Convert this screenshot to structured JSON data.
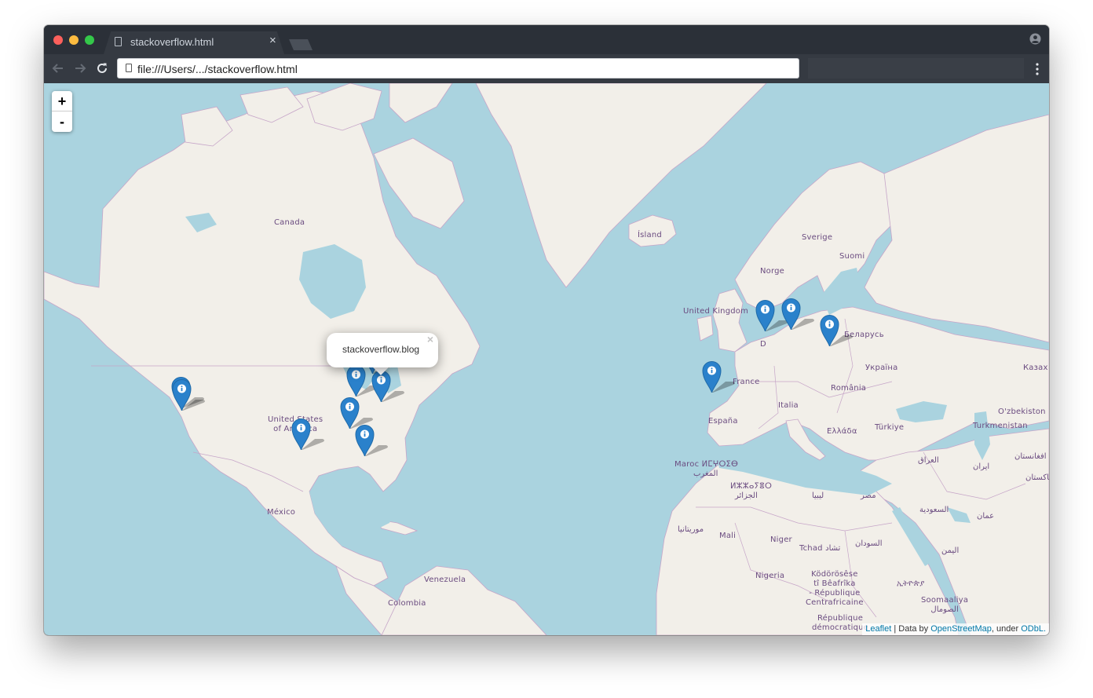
{
  "browser": {
    "tab_title": "stackoverflow.html",
    "tab_close": "×",
    "address": "file:///Users/.../stackoverflow.html"
  },
  "map": {
    "zoom_in": "+",
    "zoom_out": "-",
    "popup": {
      "text": "stackoverflow.blog",
      "close": "×"
    },
    "attribution": {
      "leaflet": "Leaflet",
      "sep1": " | Data by ",
      "osm": "OpenStreetMap",
      "sep2": ", under ",
      "odbl": "ODbL."
    },
    "labels": {
      "canada": "Canada",
      "usa": "United States\nof America",
      "mexico": "México",
      "iceland": "Ísland",
      "uk": "United Kingdom",
      "norway": "Norge",
      "sweden": "Sverige",
      "finland": "Suomi",
      "belarus": "Беларусь",
      "ukraine": "Україна",
      "france": "France",
      "romania": "România",
      "italy": "Italia",
      "spain": "España",
      "greece": "Ελλάδα",
      "turkey": "Türkiye",
      "kazakhstan": "Казах",
      "uzbekistan": "O'zbekiston",
      "turkmenistan": "Turkmenistan",
      "morocco": "Maroc ⵍⵎⵖⵔⵉⴱ",
      "morocco_ar": "المغرب",
      "algeria": "ⵍⵣⵣⴰⵢⴻⵔ",
      "algeria_ar": "الجزائر",
      "libya": "ليبيا",
      "egypt": "مصر",
      "iraq": "العراق",
      "iran": "ایران",
      "afghanistan": "افغانستان",
      "pakistan": "پاکستان",
      "saudi": "السعودية",
      "oman": "عمان",
      "yemen": "اليمن",
      "mauritania": "موريتانيا",
      "mali": "Mali",
      "niger": "Niger",
      "chad": "Tchad تشاد",
      "sudan": "السودان",
      "nigeria": "Nigeria",
      "car": "Ködörösêse\ntî Bêafrîka\n- République\nCentrafricaine",
      "ethiopia": "ኢትዮጵያ",
      "somalia": "Soomaaliya\nالصومال",
      "drc": "République\ndémocratique",
      "venezuela": "Venezuela",
      "colombia": "Colombia",
      "germany_partial": "D"
    },
    "marker_count": 13,
    "marker_color": "#2a81cb",
    "marker_icon": "info-icon"
  }
}
